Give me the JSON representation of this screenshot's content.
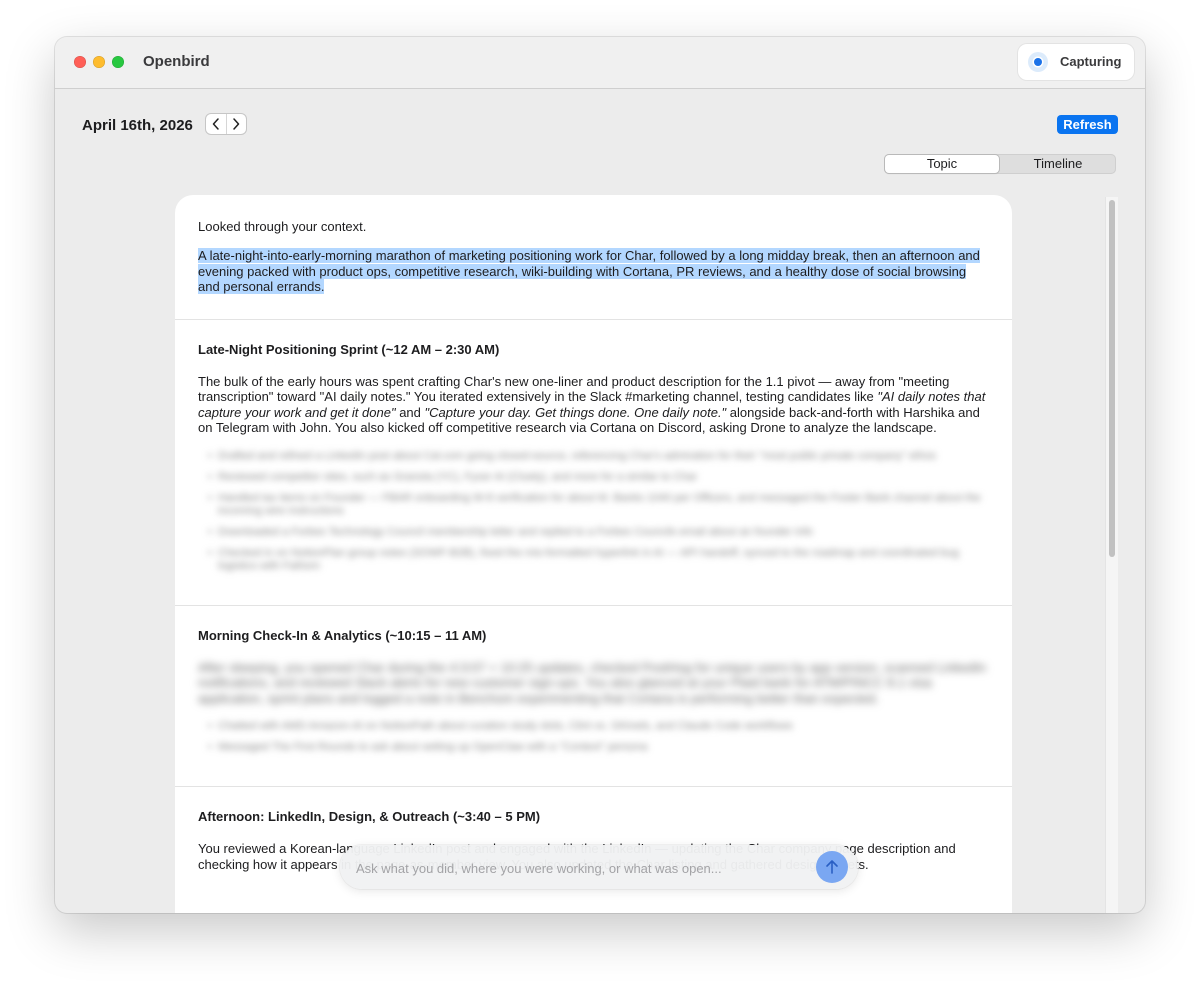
{
  "window": {
    "app_title": "Openbird",
    "capture_status": "Capturing"
  },
  "header": {
    "date": "April 16th, 2026",
    "prev_icon": "chevron-left-icon",
    "next_icon": "chevron-right-icon",
    "refresh_label": "Refresh"
  },
  "view_toggle": {
    "options": [
      "Topic",
      "Timeline"
    ],
    "selected": "Topic"
  },
  "content": {
    "intro": "Looked through your context.",
    "summary": "A late-night-into-early-morning marathon of marketing positioning work for Char, followed by a long midday break, then an afternoon and evening packed with product ops, competitive research, wiki-building with Cortana, PR reviews, and a healthy dose of social browsing and personal errands.",
    "sections": [
      {
        "title": "Late-Night Positioning Sprint (~12 AM – 2:30 AM)",
        "p1": "The bulk of the early hours was spent crafting Char's new one-liner and product description for the 1.1 pivot — away from \"meeting transcription\" toward \"AI daily notes.\" You iterated extensively in the Slack #marketing channel, testing candidates like ",
        "q1": "\"AI daily notes that capture your work and get it done\"",
        "p2": " and ",
        "q2": "\"Capture your day. Get things done. One daily note.\"",
        "p3": " alongside back-and-forth with Harshika and on Telegram with John. You also kicked off competitive research via Cortana on Discord, asking Drone to analyze the landscape.",
        "bullets": [
          "Drafted and refined a LinkedIn post about Cal.com going closed-source, referencing Char's admiration for their \"most public private company\" ethos",
          "Reviewed competitor sites, such as Granola (YC), Fyxer AI (Cluely), and more for a similar to Char",
          "Handled tax items on Founder — FBAR onboarding W-8 verification for about M. Banks 1040 per Officers, and messaged the Foster Bank channel about the incoming wire instructions",
          "Downloaded a Forbes Technology Council membership letter and replied to a Forbes Councils email about an founder info",
          "Checked in on NotionPlan group notes (SOWF-B2B), fixed the mis-formatted hyperlink in AI — API handoff, synced to the roadmap and coordinated bug logistics with Fathom"
        ]
      },
      {
        "title": "Morning Check-In & Analytics (~10:15 – 11 AM)",
        "para": "After sleeping, you opened Char during the 4:3:07 + 10:25 updates, checked PostHog for unique users by app version, scanned LinkedIn notifications, and reviewed Slack alerts for new customer sign-ups. You also glanced at your Plaid bank for ATM/PINCC 8.1 visa application, sprint plans and logged a note in Benchom experimenting that Cortana is performing better than expected.",
        "bullets": [
          "Chatted with AMD Amazon-Al on NotionPath about curation study slots, Clint vs. GKinels, and Claude Code workflows",
          "Messaged The First Rounds to ask about setting up OpenClaw with a \"Context\" persona"
        ]
      },
      {
        "title": "Afternoon: LinkedIn, Design, & Outreach (~3:40 – 5 PM)",
        "para": "You reviewed a Korean-language LinkedIn post and engaged with the LinkedIn — updating the Char company page description and checking how it appears in the page-as-member view. You also updated the Char listing and gathered design assets."
      }
    ]
  },
  "ask": {
    "placeholder": "Ask what you did, where you were working, or what was open...",
    "send_icon": "arrow-up-icon"
  }
}
